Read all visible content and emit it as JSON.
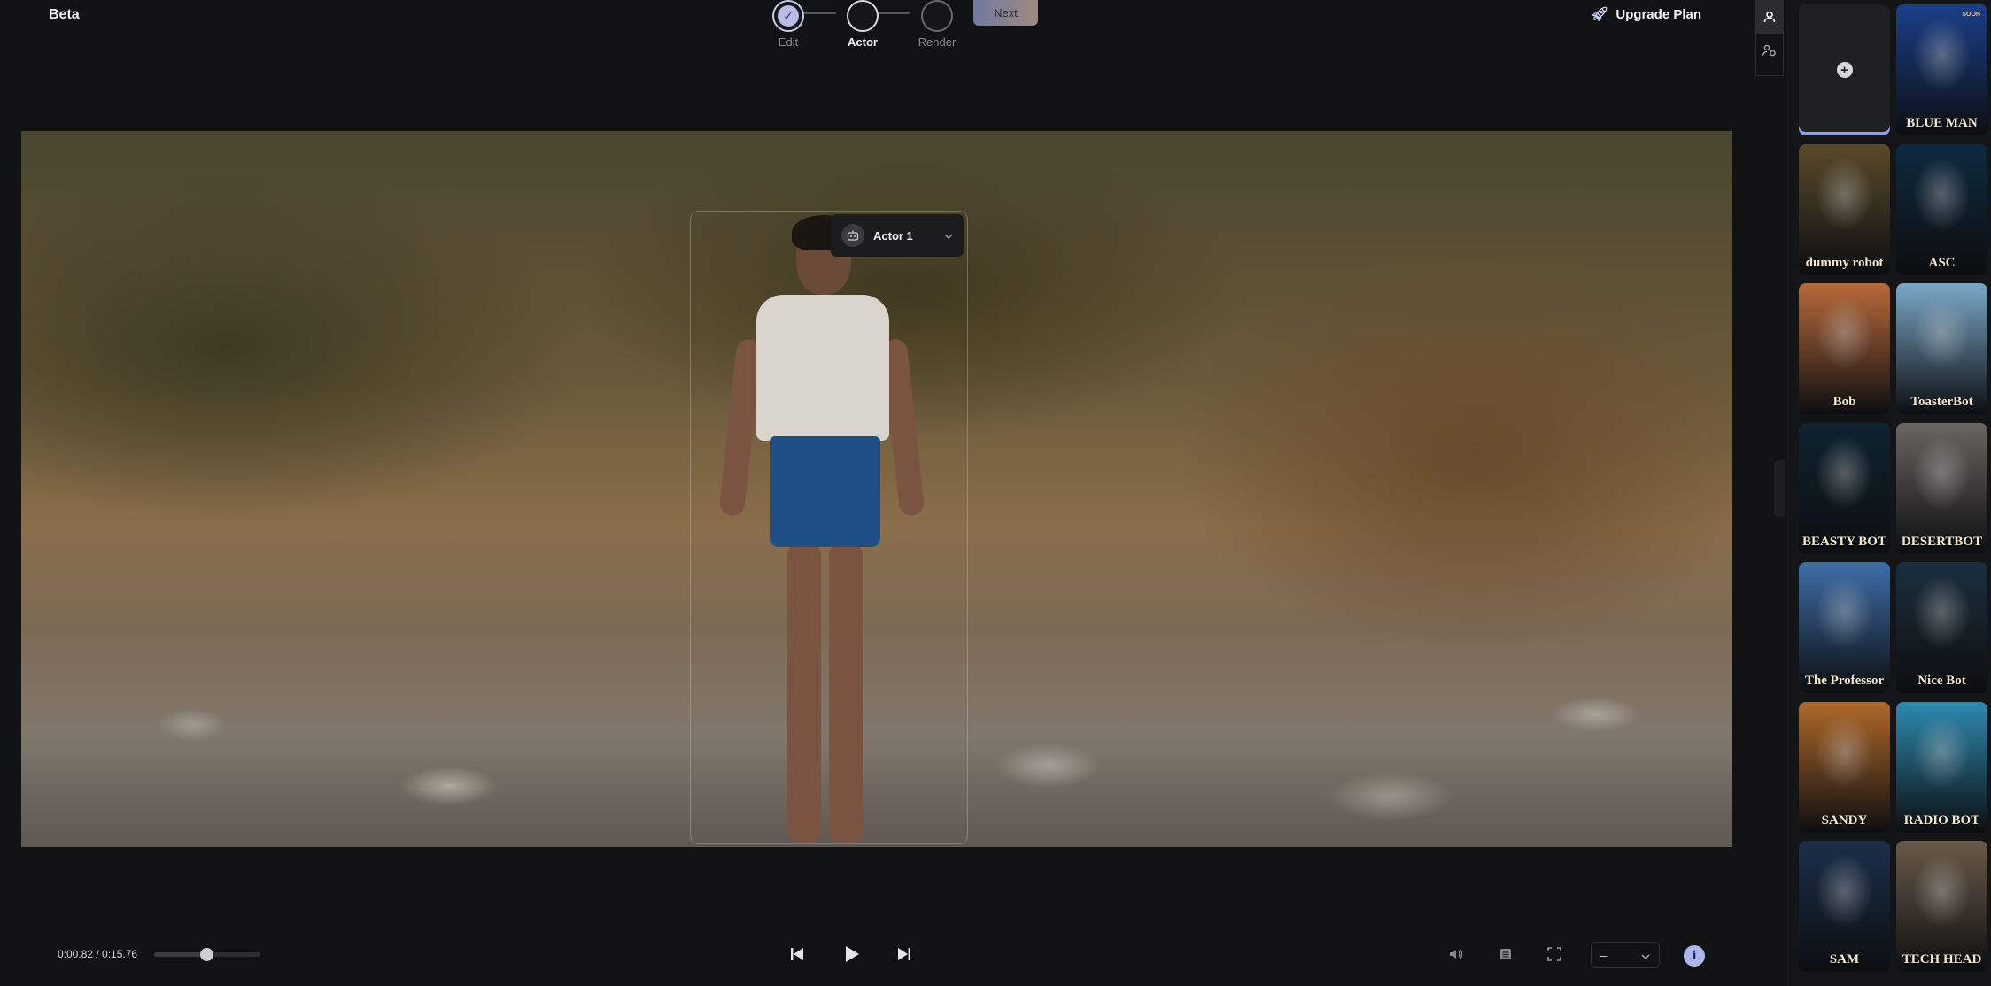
{
  "app": {
    "brand": "Beta"
  },
  "stepper": {
    "steps": [
      {
        "label": "Edit",
        "state": "done"
      },
      {
        "label": "Actor",
        "state": "active"
      },
      {
        "label": "Render",
        "state": "pending"
      }
    ],
    "next_label": "Next"
  },
  "header": {
    "upgrade_label": "Upgrade Plan"
  },
  "tools": [
    {
      "icon": "person-icon",
      "selected": true
    },
    {
      "icon": "person-settings-icon",
      "selected": false
    }
  ],
  "video": {
    "actor_tag": {
      "label": "Actor 1"
    }
  },
  "player": {
    "timecode": "0:00.82 / 0:15.76",
    "scrub_level": 0.49,
    "speed_value": "–"
  },
  "actors_panel": {
    "tiles": [
      {
        "type": "add"
      },
      {
        "name": "BLUE MAN",
        "badge": "SOON",
        "color": "#1a3f8a"
      },
      {
        "name": "dummy robot",
        "color": "#5a4a2a"
      },
      {
        "name": "ASC",
        "color": "#0d2a3e"
      },
      {
        "name": "Bob",
        "color": "#b86a3a"
      },
      {
        "name": "ToasterBot",
        "color": "#7aa8c8"
      },
      {
        "name": "BEASTY BOT",
        "color": "#0e2330"
      },
      {
        "name": "DESERTBOT",
        "color": "#6a6660"
      },
      {
        "name": "The Professor",
        "color": "#3d6fa8"
      },
      {
        "name": "Nice Bot",
        "color": "#1c2f3e"
      },
      {
        "name": "SANDY",
        "color": "#b0692a"
      },
      {
        "name": "RADIO BOT",
        "color": "#2e8ab0"
      },
      {
        "name": "SAM",
        "color": "#1a2f4a"
      },
      {
        "name": "TECH HEAD",
        "color": "#6a5a48"
      }
    ]
  },
  "colors": {
    "accent": "#aeb6f0",
    "background": "#111213"
  }
}
